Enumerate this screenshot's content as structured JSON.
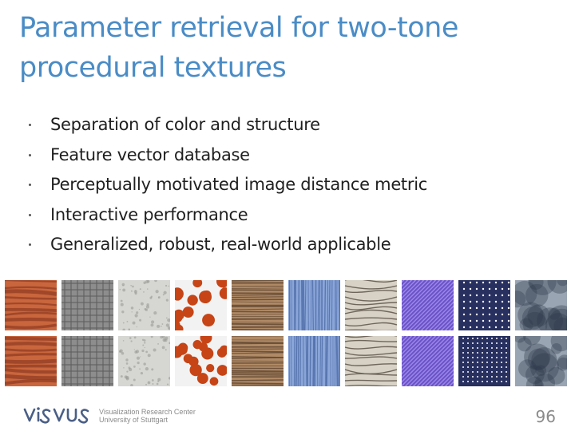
{
  "slide": {
    "title": "Parameter retrieval for two-tone procedural textures",
    "bullets": [
      "Separation of color and structure",
      "Feature vector database",
      "Perceptually motivated image distance metric",
      "Interactive performance",
      "Generalized, robust, real-world applicable"
    ],
    "textures": [
      {
        "name": "rust",
        "colors": [
          "#c9663d",
          "#8e3b22"
        ]
      },
      {
        "name": "metal-grid",
        "colors": [
          "#8d8d8d",
          "#5c5c5c"
        ]
      },
      {
        "name": "granite",
        "colors": [
          "#d6d6d2",
          "#9a9a96"
        ]
      },
      {
        "name": "red-dots",
        "colors": [
          "#f2f2f2",
          "#c64416"
        ]
      },
      {
        "name": "wood",
        "colors": [
          "#b08a66",
          "#5e4530"
        ]
      },
      {
        "name": "blue-wood",
        "colors": [
          "#8aa6d8",
          "#4f6ba8"
        ]
      },
      {
        "name": "grain",
        "colors": [
          "#d8d2c6",
          "#6f665b"
        ]
      },
      {
        "name": "purple-stripes",
        "colors": [
          "#9a86e6",
          "#6a52c8"
        ]
      },
      {
        "name": "polka-dots",
        "colors": [
          "#27305f",
          "#ffffff"
        ]
      },
      {
        "name": "clouds",
        "colors": [
          "#9aa5b3",
          "#2f3a4a"
        ]
      }
    ],
    "footer": {
      "org_line1": "Visualization Research Center",
      "org_line2": "University of Stuttgart",
      "page_number": "96"
    }
  }
}
